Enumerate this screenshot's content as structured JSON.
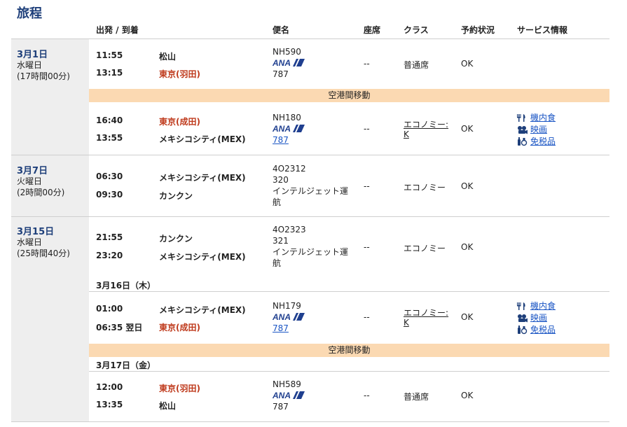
{
  "page_title": "旅程",
  "headers": {
    "depart_arrive": "出発 / 到着",
    "flight": "便名",
    "seat": "座席",
    "class": "クラス",
    "status": "予約状況",
    "service": "サービス情報"
  },
  "days": [
    {
      "date": "3月1日",
      "weekday": "水曜日",
      "duration": "(17時間00分)"
    },
    {
      "date": "3月7日",
      "weekday": "火曜日",
      "duration": "(2時間00分)"
    },
    {
      "date": "3月15日",
      "weekday": "水曜日",
      "duration": "(25時間40分)"
    }
  ],
  "segments": [
    {
      "dep_time": "11:55",
      "dep_city": "松山",
      "arr_time": "13:15",
      "arr_city": "東京(羽田)",
      "flight_no": "NH590",
      "aircraft": "787",
      "seat": "--",
      "class": "普通席",
      "status": "OK"
    },
    {
      "dep_time": "16:40",
      "dep_city": "東京(成田)",
      "arr_time": "13:55",
      "arr_city": "メキシコシティ(MEX)",
      "flight_no": "NH180",
      "aircraft": "787",
      "seat": "--",
      "class_line1": "エコノミー:",
      "class_line2": "K",
      "status": "OK"
    },
    {
      "dep_time": "06:30",
      "dep_city": "メキシコシティ(MEX)",
      "arr_time": "09:30",
      "arr_city": "カンクン",
      "flight_no": "4O2312",
      "aircraft": "320",
      "operator_line1": "インテルジェット運",
      "operator_line2": "航",
      "seat": "--",
      "class": "エコノミー",
      "status": "OK"
    },
    {
      "dep_time": "21:55",
      "dep_city": "カンクン",
      "arr_time": "23:20",
      "arr_city": "メキシコシティ(MEX)",
      "flight_no": "4O2323",
      "aircraft": "321",
      "operator_line1": "インテルジェット運",
      "operator_line2": "航",
      "seat": "--",
      "class": "エコノミー",
      "status": "OK"
    },
    {
      "dep_time": "01:00",
      "dep_city": "メキシコシティ(MEX)",
      "arr_time": "06:35 翌日",
      "arr_city": "東京(成田)",
      "flight_no": "NH179",
      "aircraft": "787",
      "seat": "--",
      "class_line1": "エコノミー:",
      "class_line2": "K",
      "status": "OK"
    },
    {
      "dep_time": "12:00",
      "dep_city": "東京(羽田)",
      "arr_time": "13:35",
      "arr_city": "松山",
      "flight_no": "NH589",
      "aircraft": "787",
      "seat": "--",
      "class": "普通席",
      "status": "OK"
    }
  ],
  "transfer_label": "空港間移動",
  "sub_dates": [
    "3月16日（木）",
    "3月17日（金）"
  ],
  "services": {
    "meal": "機内食",
    "movie": "映画",
    "duty_free": "免税品"
  },
  "airline_logo": "ANA",
  "colors": {
    "title": "#1e3f7a",
    "band": "#fbd9b2",
    "date_cell": "#eeeeee",
    "link": "#1a55c4",
    "city_highlight": "#bf3a1c",
    "logo": "#1f3f8f"
  }
}
